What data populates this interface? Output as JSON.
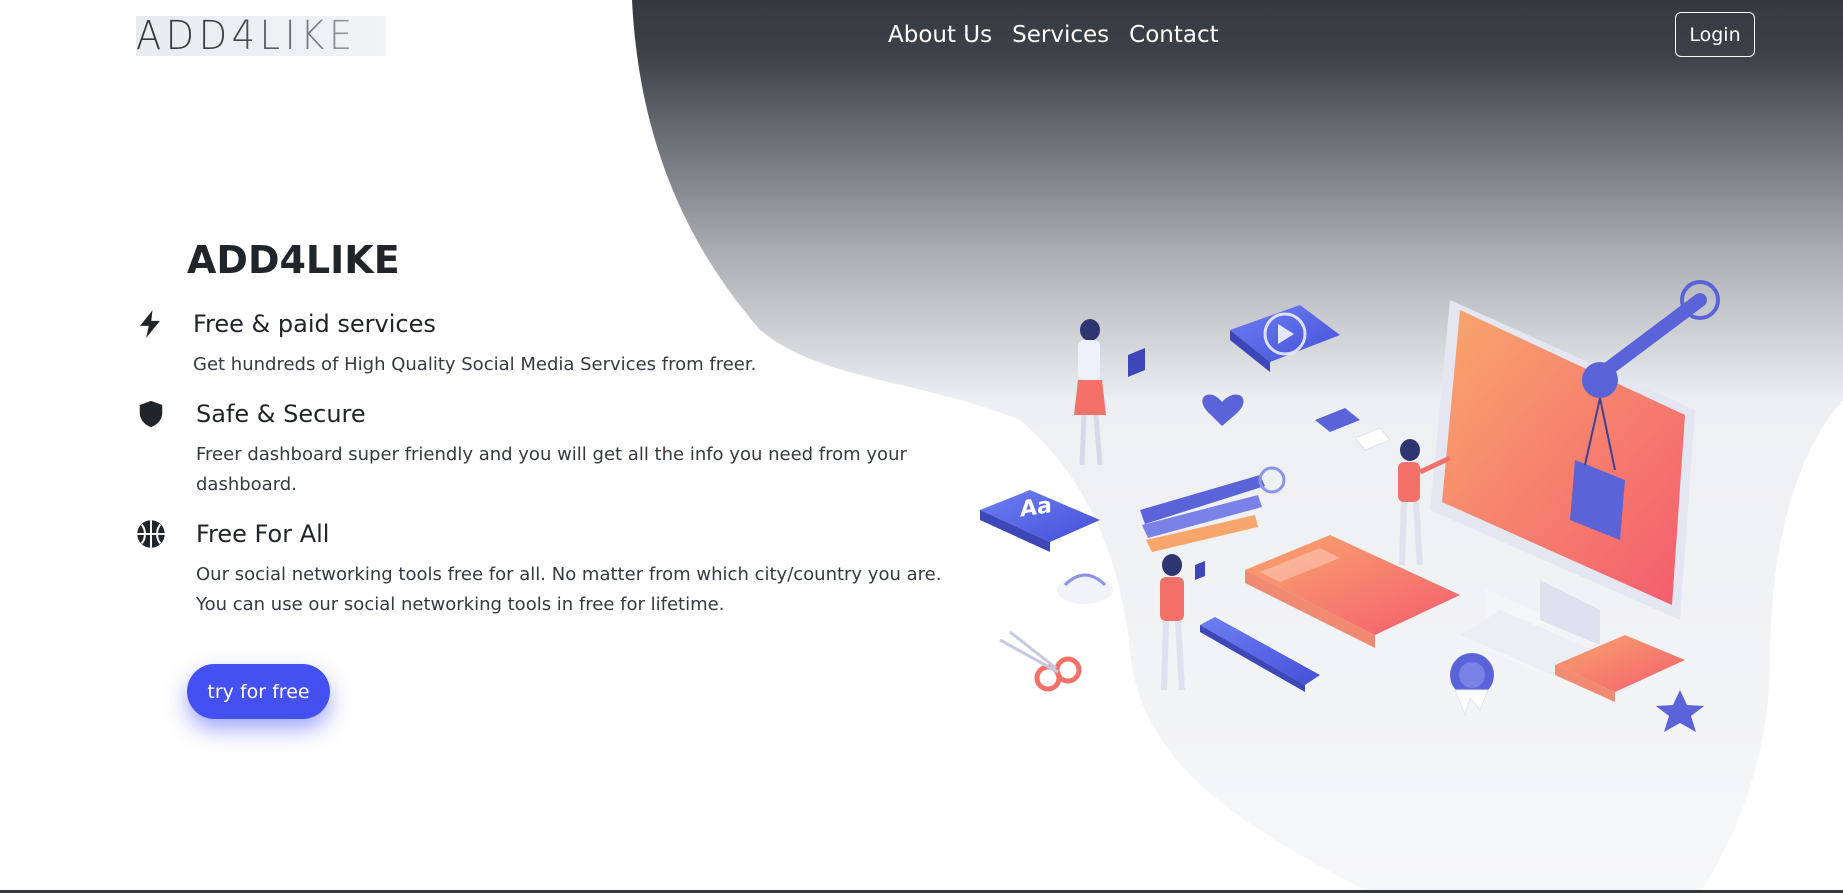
{
  "header": {
    "logo_text": "ADD4LIKE",
    "nav": [
      "About Us",
      "Services",
      "Contact"
    ],
    "login_label": "Login"
  },
  "hero": {
    "title": "ADD4LIKE",
    "features": [
      {
        "icon": "lightning-icon",
        "title": "Free & paid services",
        "desc": "Get hundreds of High Quality Social Media Services from freer."
      },
      {
        "icon": "shield-icon",
        "title": "Safe & Secure",
        "desc": "Freer dashboard super friendly and you will get all the info you need from your dashboard."
      },
      {
        "icon": "basketball-icon",
        "title": "Free For All",
        "desc": "Our social networking tools free for all. No matter from which city/country you are. You can use our social networking tools in free for lifetime."
      }
    ],
    "cta_label": "try for free"
  },
  "colors": {
    "blob_dark": "#343a40",
    "cta": "#4450f2",
    "text": "#212529"
  }
}
